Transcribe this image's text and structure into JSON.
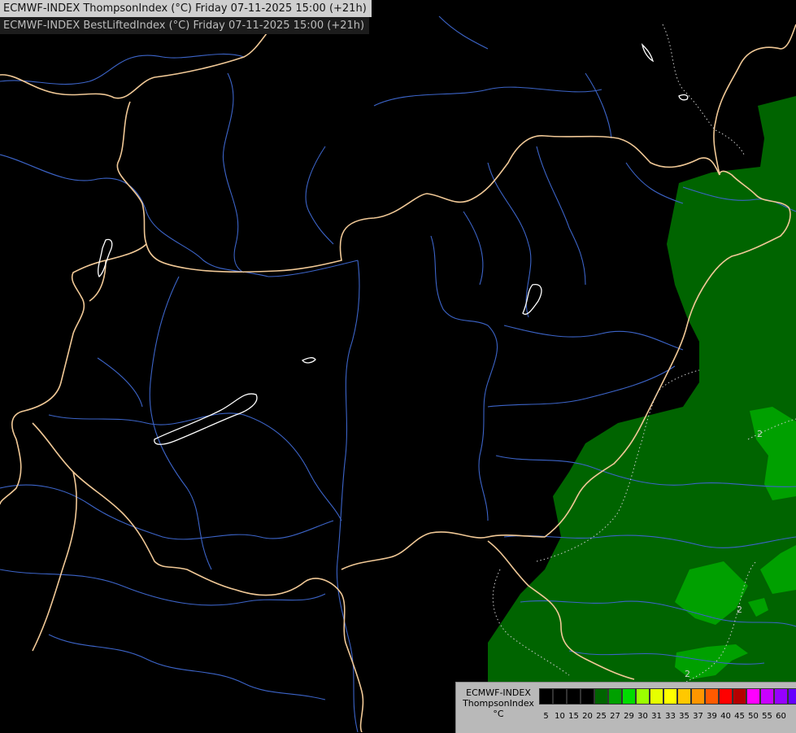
{
  "titles": {
    "line1": "ECMWF-INDEX ThompsonIndex (°C) Friday 07-11-2025 15:00 (+21h)",
    "line2": "ECMWF-INDEX BestLiftedIndex (°C) Friday 07-11-2025 15:00 (+21h)"
  },
  "map": {
    "background": "#000000",
    "border_color": "#f0c896",
    "river_color": "#3c64c8",
    "lake_outline_color": "#ffffff",
    "contour_color": "#cfcfcf",
    "fields": [
      {
        "name": "ThompsonIndex 20-25",
        "color": "#006400"
      },
      {
        "name": "ThompsonIndex 25-27",
        "color": "#009600"
      }
    ],
    "contour_labels": [
      "2",
      "2",
      "2"
    ]
  },
  "legend": {
    "model": "ECMWF-INDEX",
    "parameter": "ThompsonIndex",
    "unit": "°C",
    "colors": [
      "#000000",
      "#000000",
      "#000000",
      "#000000",
      "#006400",
      "#00a000",
      "#00dc00",
      "#9bff00",
      "#e6ff00",
      "#ffff00",
      "#ffc800",
      "#ff9600",
      "#ff5a00",
      "#ff0000",
      "#b40000",
      "#ff00ff",
      "#c800ff",
      "#9600ff",
      "#6400ff",
      "#0000ff"
    ],
    "ticks": [
      "5",
      "10",
      "15",
      "20",
      "25",
      "27",
      "29",
      "30",
      "31",
      "33",
      "35",
      "37",
      "39",
      "40",
      "45",
      "50",
      "55",
      "60"
    ]
  }
}
